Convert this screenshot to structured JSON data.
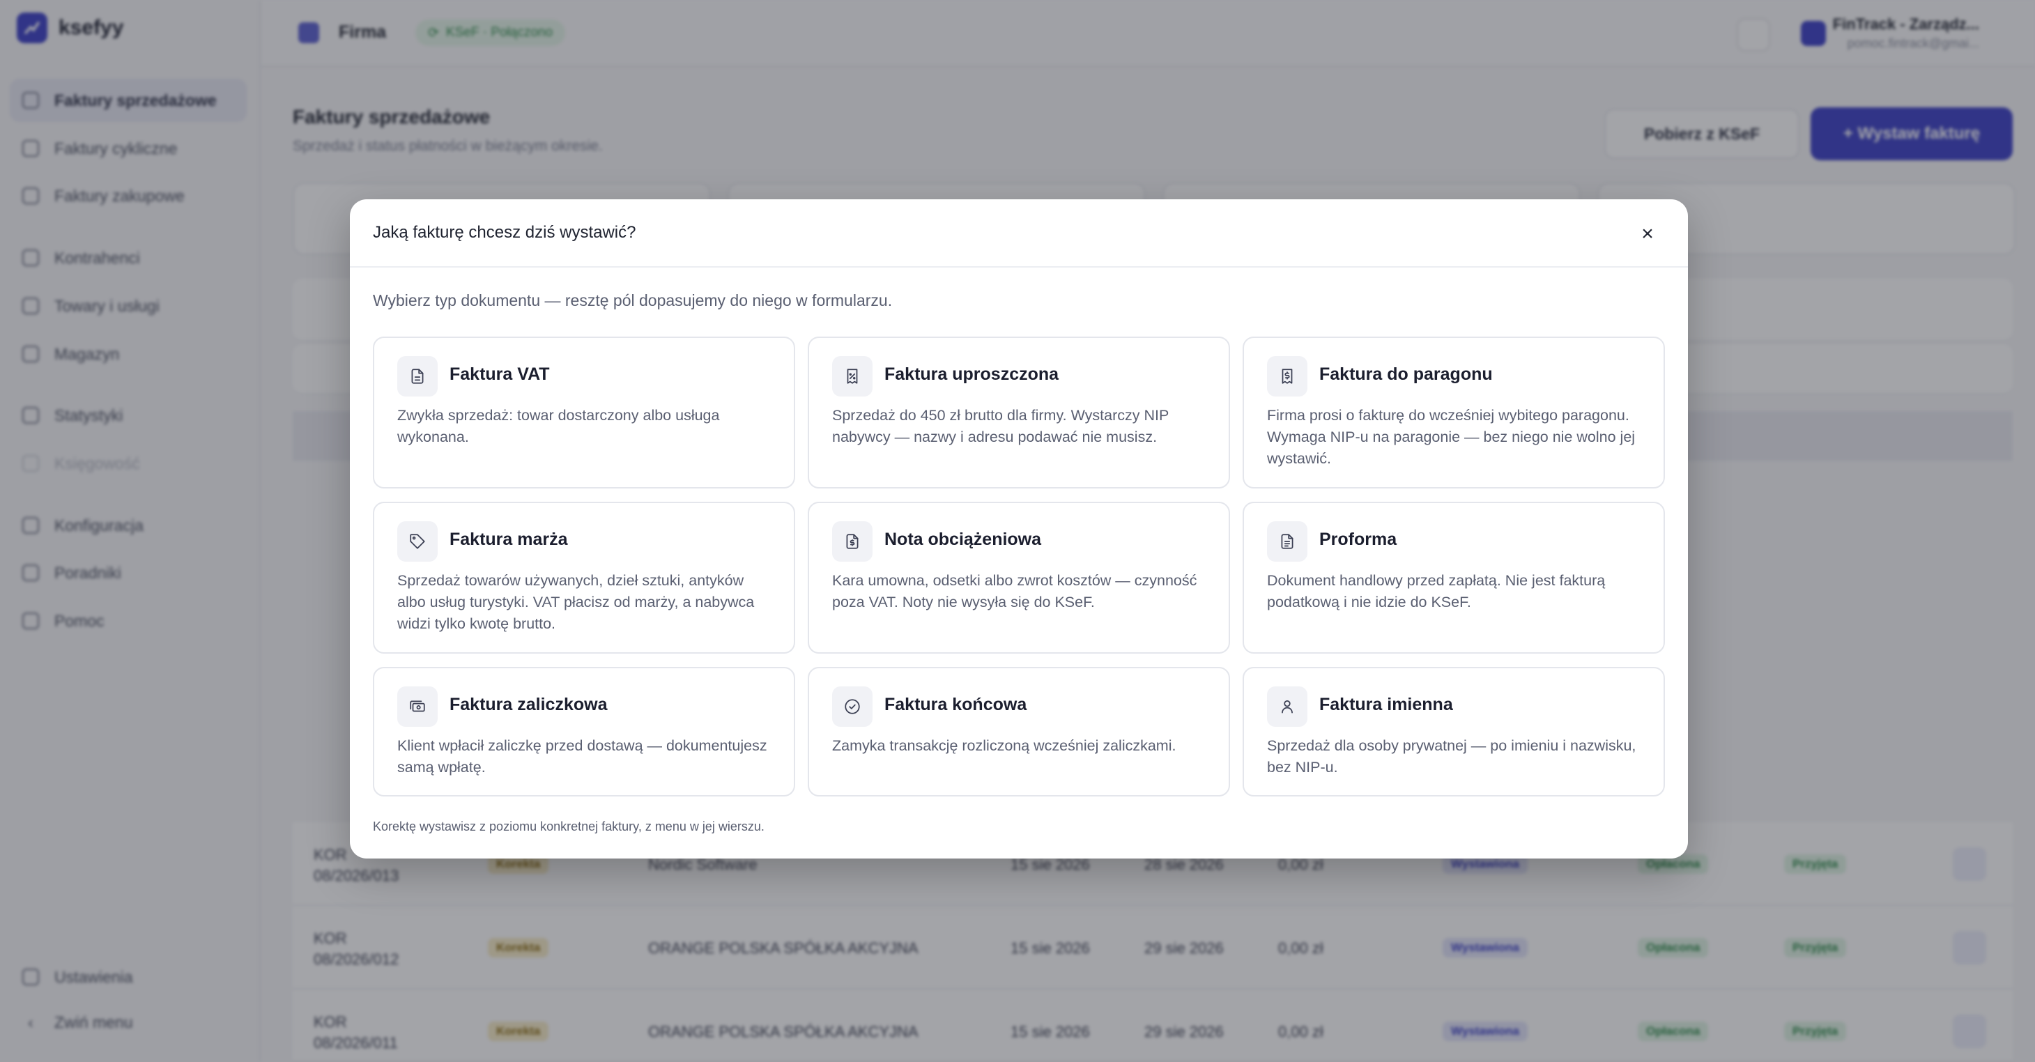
{
  "app": {
    "logo": "ksefyy",
    "sidebar": {
      "items": [
        {
          "label": "Faktury sprzedażowe",
          "icon": "file-icon"
        },
        {
          "label": "Faktury cykliczne",
          "icon": "repeat-icon"
        },
        {
          "label": "Faktury zakupowe",
          "icon": "file-icon"
        },
        {
          "label": "Kontrahenci",
          "icon": "users-icon"
        },
        {
          "label": "Towary i usługi",
          "icon": "globe-icon"
        },
        {
          "label": "Magazyn",
          "icon": "warehouse-icon"
        },
        {
          "label": "Statystyki",
          "icon": "chart-icon"
        },
        {
          "label": "Księgowość",
          "icon": "book-icon"
        },
        {
          "label": "Konfiguracja",
          "icon": "settings-icon"
        },
        {
          "label": "Poradniki",
          "icon": "book-open-icon"
        },
        {
          "label": "Pomoc",
          "icon": "help-icon"
        }
      ],
      "settings": "Ustawienia",
      "collapse": "Zwiń menu"
    },
    "topbar": {
      "firm": "Firma",
      "ksef_status": "KSeF · Połączono",
      "account_name": "FinTrack - Zarządz...",
      "account_email": "pomoc.fintrack@gmai..."
    },
    "page": {
      "title": "Faktury sprzedażowe",
      "subtitle": "Sprzedaż i status płatności w bieżącym okresie.",
      "btn_ksef": "Pobierz z KSeF",
      "btn_issue": "+  Wystaw fakturę"
    },
    "table_bg": [
      {
        "number": "KOR 08/2026/013",
        "type": "Korekta",
        "client": "Nordic Software",
        "date1": "15 sie 2026",
        "date2": "28 sie 2026",
        "amount": "0,00 zł",
        "status": "Wystawiona",
        "payment": "Opłacona",
        "ksef": "Przyjęta"
      },
      {
        "number": "KOR 08/2026/012",
        "type": "Korekta",
        "client": "ORANGE POLSKA SPÓŁKA AKCYJNA",
        "date1": "15 sie 2026",
        "date2": "29 sie 2026",
        "amount": "0,00 zł",
        "status": "Wystawiona",
        "payment": "Opłacona",
        "ksef": "Przyjęta"
      },
      {
        "number": "KOR 08/2026/011",
        "type": "Korekta",
        "client": "ORANGE POLSKA SPÓŁKA AKCYJNA",
        "date1": "15 sie 2026",
        "date2": "29 sie 2026",
        "amount": "0,00 zł",
        "status": "Wystawiona",
        "payment": "Opłacona",
        "ksef": "Przyjęta"
      }
    ]
  },
  "modal": {
    "title": "Jaką fakturę chcesz dziś wystawić?",
    "close_label": "×",
    "intro": "Wybierz typ dokumentu — resztę pól dopasujemy do niego w formularzu.",
    "cards": [
      {
        "title": "Faktura VAT",
        "desc": "Zwykła sprzedaż: towar dostarczony albo usługa wykonana.",
        "icon": "document-icon"
      },
      {
        "title": "Faktura uproszczona",
        "desc": "Sprzedaż do 450 zł brutto dla firmy. Wystarczy NIP nabywcy — nazwy i adresu podawać nie musisz.",
        "icon": "receipt-percent-icon"
      },
      {
        "title": "Faktura do paragonu",
        "desc": "Firma prosi o fakturę do wcześniej wybitego paragonu. Wymaga NIP-u na paragonie — bez niego nie wolno jej wystawić.",
        "icon": "receipt-icon"
      },
      {
        "title": "Faktura marża",
        "desc": "Sprzedaż towarów używanych, dzieł sztuki, antyków albo usług turystyki. VAT płacisz od marży, a nabywca widzi tylko kwotę brutto.",
        "icon": "tag-icon"
      },
      {
        "title": "Nota obciążeniowa",
        "desc": "Kara umowna, odsetki albo zwrot kosztów — czynność poza VAT. Noty nie wysyła się do KSeF.",
        "icon": "file-dollar-icon"
      },
      {
        "title": "Proforma",
        "desc": "Dokument handlowy przed zapłatą. Nie jest fakturą podatkową i nie idzie do KSeF.",
        "icon": "file-text-icon"
      },
      {
        "title": "Faktura zaliczkowa",
        "desc": "Klient wpłacił zaliczkę przed dostawą — dokumentujesz samą wpłatę.",
        "icon": "cash-icon"
      },
      {
        "title": "Faktura końcowa",
        "desc": "Zamyka transakcję rozliczoną wcześniej zaliczkami.",
        "icon": "check-circle-icon"
      },
      {
        "title": "Faktura imienna",
        "desc": "Sprzedaż dla osoby prywatnej — po imieniu i nazwisku, bez NIP-u.",
        "icon": "user-icon"
      }
    ],
    "footer": "Korektę wystawisz z poziomu konkretnej faktury, z menu w jej wierszu."
  },
  "colors": {
    "accent": "#3b3fc6",
    "overlay": "#232630"
  }
}
